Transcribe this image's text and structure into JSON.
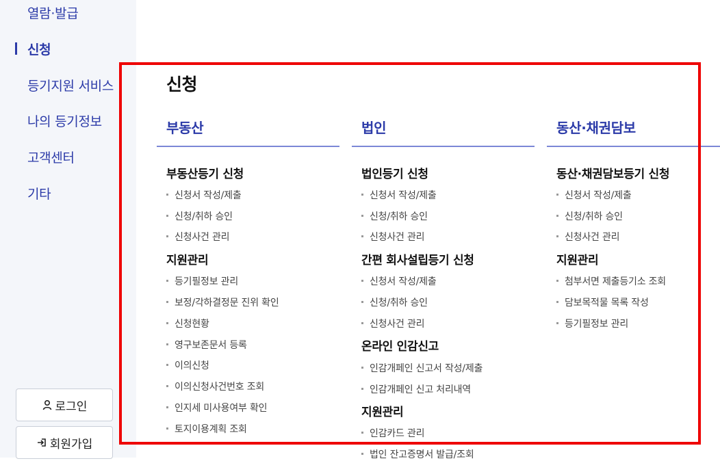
{
  "sidebar": {
    "items": [
      {
        "label": "열람·발급"
      },
      {
        "label": "신청"
      },
      {
        "label": "등기지원 서비스"
      },
      {
        "label": "나의 등기정보"
      },
      {
        "label": "고객센터"
      },
      {
        "label": "기타"
      }
    ],
    "login_label": "로그인",
    "signup_label": "회원가입"
  },
  "main": {
    "title": "신청",
    "columns": [
      {
        "heading": "부동산",
        "groups": [
          {
            "title": "부동산등기 신청",
            "links": [
              "신청서 작성/제출",
              "신청/취하 승인",
              "신청사건 관리"
            ]
          },
          {
            "title": "지원관리",
            "links": [
              "등기필정보 관리",
              "보정/각하결정문 진위 확인",
              "신청현황",
              "영구보존문서 등록",
              "이의신청",
              "이의신청사건번호 조회",
              "인지세 미사용여부 확인",
              "토지이용계획 조회"
            ]
          }
        ]
      },
      {
        "heading": "법인",
        "groups": [
          {
            "title": "법인등기 신청",
            "links": [
              "신청서 작성/제출",
              "신청/취하 승인",
              "신청사건 관리"
            ]
          },
          {
            "title": "간편 회사설립등기 신청",
            "links": [
              "신청서 작성/제출",
              "신청/취하 승인",
              "신청사건 관리"
            ]
          },
          {
            "title": "온라인 인감신고",
            "links": [
              "인감개페인 신고서 작성/제출",
              "인감개페인 신고 처리내역"
            ]
          },
          {
            "title": "지원관리",
            "links": [
              "인감카드 관리",
              "법인 잔고증명서 발급/조회"
            ]
          }
        ]
      },
      {
        "heading": "동산·채권담보",
        "groups": [
          {
            "title": "동산·채권담보등기 신청",
            "links": [
              "신청서 작성/제출",
              "신청/취하 승인",
              "신청사건 관리"
            ]
          },
          {
            "title": "지원관리",
            "links": [
              "첨부서면 제출등기소 조회",
              "담보목적물 목록 작성",
              "등기필정보 관리"
            ]
          }
        ]
      }
    ]
  },
  "colors": {
    "accent": "#2b3aa8",
    "highlight": "#ee0000",
    "sidebar_bg": "#f4f6fa"
  }
}
